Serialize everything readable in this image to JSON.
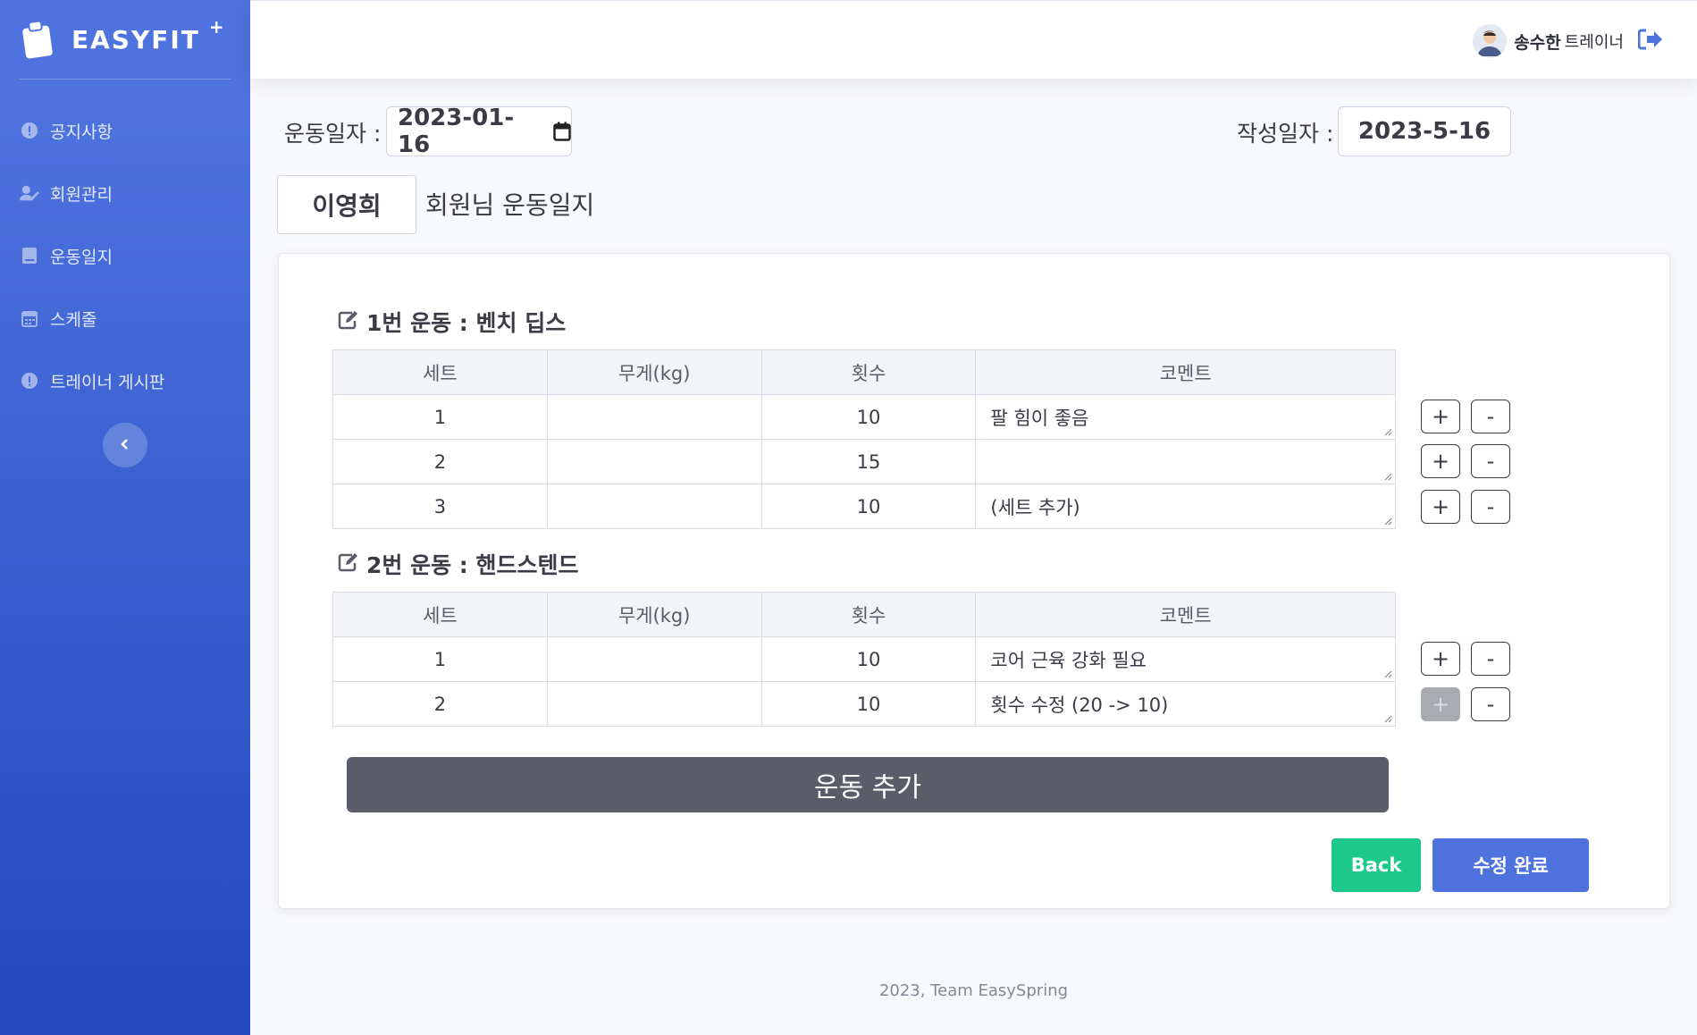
{
  "brand": {
    "name": "EASYFIT",
    "plus": "+"
  },
  "sidebar": {
    "items": [
      {
        "label": "공지사항",
        "icon": "exclamation-circle-icon"
      },
      {
        "label": "회원관리",
        "icon": "user-edit-icon"
      },
      {
        "label": "운동일지",
        "icon": "book-icon"
      },
      {
        "label": "스케줄",
        "icon": "calendar-icon"
      },
      {
        "label": "트레이너 게시판",
        "icon": "exclamation-circle-icon"
      }
    ],
    "toggle_icon": "chevron-left-icon"
  },
  "topbar": {
    "user_name": "송수한",
    "user_role": "트레이너",
    "logout_icon": "sign-out-icon"
  },
  "header": {
    "exercise_date_label": "운동일자 :",
    "exercise_date_value": "2023-01-16",
    "written_date_label": "작성일자 :",
    "written_date_value": "2023-5-16",
    "member_name": "이영희",
    "title_suffix": "회원님 운동일지"
  },
  "table_headers": {
    "set": "세트",
    "weight": "무게(kg)",
    "reps": "횟수",
    "comment": "코멘트"
  },
  "exercises": [
    {
      "title": "1번 운동 : 벤치 딥스",
      "rows": [
        {
          "set": "1",
          "weight": "",
          "reps": "10",
          "comment": "팔 힘이 좋음"
        },
        {
          "set": "2",
          "weight": "",
          "reps": "15",
          "comment": ""
        },
        {
          "set": "3",
          "weight": "",
          "reps": "10",
          "comment": "(세트 추가)"
        }
      ]
    },
    {
      "title": "2번 운동 : 핸드스텐드",
      "rows": [
        {
          "set": "1",
          "weight": "",
          "reps": "10",
          "comment": "코어 근육 강화 필요"
        },
        {
          "set": "2",
          "weight": "",
          "reps": "10",
          "comment": "횟수 수정 (20 -> 10)"
        }
      ]
    }
  ],
  "buttons": {
    "plus": "+",
    "minus": "-",
    "add_exercise": "운동 추가",
    "back": "Back",
    "done": "수정 완료"
  },
  "footer": {
    "text": "2023, Team EasySpring"
  },
  "colors": {
    "primary": "#4e73df",
    "success": "#1cc88a",
    "dark": "#5a5c69"
  }
}
